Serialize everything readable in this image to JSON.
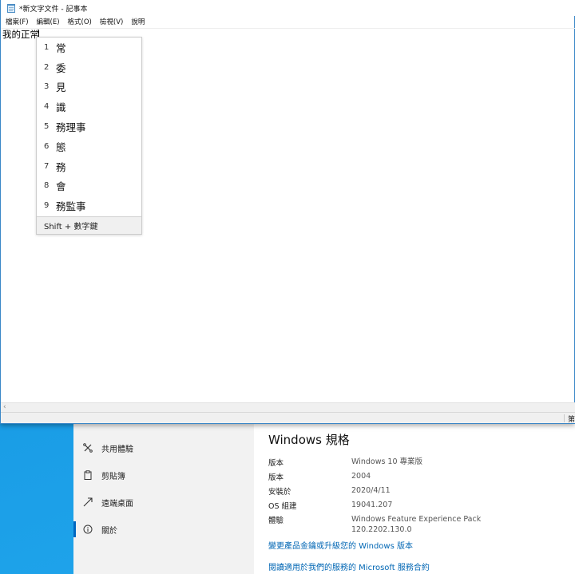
{
  "notepad": {
    "title": "*新文字文件 - 記事本",
    "menu": [
      "檔案(F)",
      "編輯(E)",
      "格式(O)",
      "檢視(V)",
      "說明"
    ],
    "text": "我的正常",
    "status": "第"
  },
  "ime": {
    "candidates": [
      {
        "num": "1",
        "text": "常"
      },
      {
        "num": "2",
        "text": "委"
      },
      {
        "num": "3",
        "text": "見"
      },
      {
        "num": "4",
        "text": "識"
      },
      {
        "num": "5",
        "text": "務理事"
      },
      {
        "num": "6",
        "text": "態"
      },
      {
        "num": "7",
        "text": "務"
      },
      {
        "num": "8",
        "text": "會"
      },
      {
        "num": "9",
        "text": "務監事"
      }
    ],
    "footer": "Shift + 數字鍵"
  },
  "settings": {
    "sidebar": [
      {
        "label": "共用體驗",
        "icon": "shared-experience-icon"
      },
      {
        "label": "剪貼簿",
        "icon": "clipboard-icon"
      },
      {
        "label": "遠端桌面",
        "icon": "remote-desktop-icon"
      },
      {
        "label": "關於",
        "icon": "info-icon"
      }
    ],
    "title": "Windows 規格",
    "specs": [
      {
        "key": "版本",
        "value": "Windows 10 專業版"
      },
      {
        "key": "版本",
        "value": "2004"
      },
      {
        "key": "安裝於",
        "value": "2020/4/11"
      },
      {
        "key": "OS 組建",
        "value": "19041.207"
      },
      {
        "key": "體驗",
        "value": "Windows Feature Experience Pack",
        "value2": "120.2202.130.0"
      }
    ],
    "links": [
      "變更產品金鑰或升級您的 Windows 版本",
      "閱讀適用於我們的服務的 Microsoft 服務合約"
    ]
  },
  "colors": {
    "accent": "#0067c0",
    "link": "#0066b4",
    "wallpaper": "#1a8fd8"
  }
}
